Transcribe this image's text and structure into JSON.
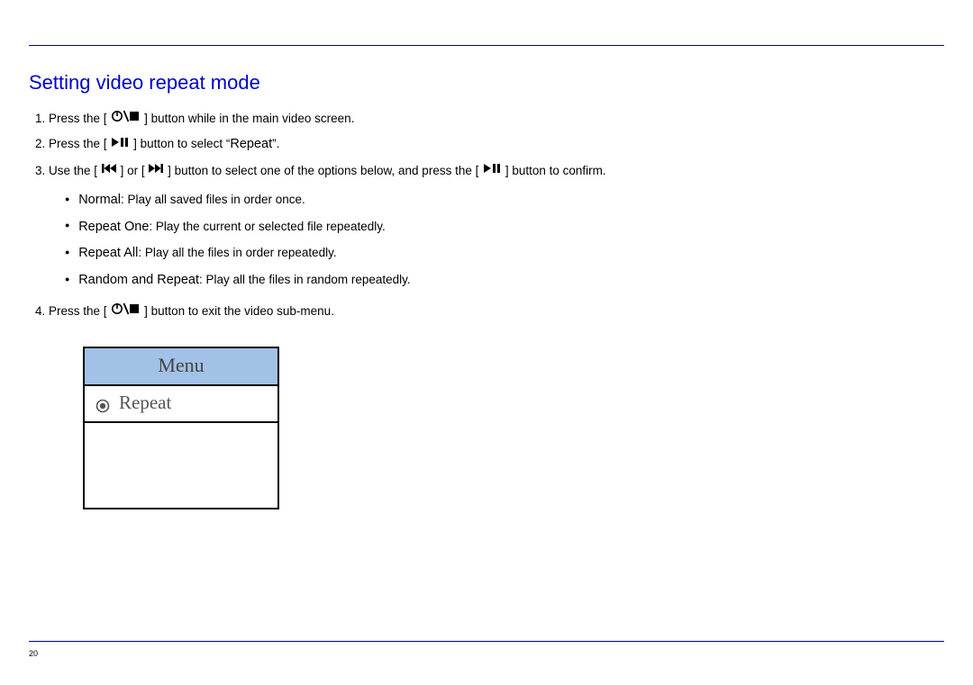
{
  "heading": "Setting video repeat mode",
  "steps": {
    "s1_a": "Press the [",
    "s1_b": "] button while in the main video screen.",
    "s2_a": "Press the [",
    "s2_b": "] button to select “",
    "s2_c": "Repeat",
    "s2_d": "”.",
    "s3_a": "Use the [",
    "s3_b": "] or [",
    "s3_c": "] button to select one of the options below, and press the [",
    "s3_d": "] button to confirm.",
    "s4_a": "Press the [",
    "s4_b": "] button to exit the video sub-menu."
  },
  "options": {
    "normal_name": "Normal",
    "normal_desc": ": Play all saved files in order once.",
    "repeat_one_name": "Repeat One",
    "repeat_one_desc": ": Play the current or selected file repeatedly.",
    "repeat_all_name": "Repeat All",
    "repeat_all_desc": ": Play all the files in order repeatedly.",
    "random_name": "Random and Repeat",
    "random_desc": ": Play all the files in random repeatedly."
  },
  "menu": {
    "title": "Menu",
    "item": "Repeat"
  },
  "page_number": "20"
}
